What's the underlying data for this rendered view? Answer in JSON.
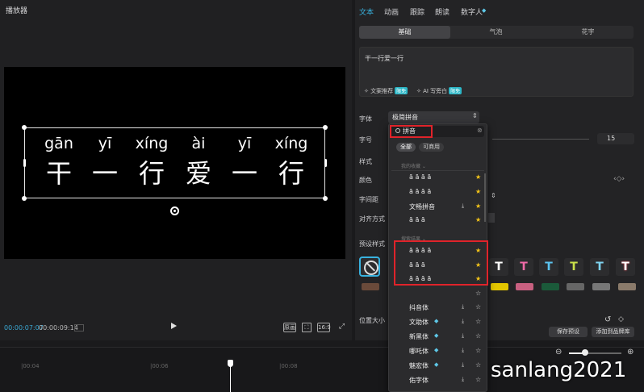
{
  "player": {
    "title": "播放器",
    "menu_icon": "hamburger-icon",
    "pinyin": [
      "gān",
      "yī",
      "xíng",
      "ài",
      "yī",
      "xíng"
    ],
    "hanzi": [
      "干",
      "一",
      "行",
      "爱",
      "一",
      "行"
    ],
    "time_current": "00:00:07:07",
    "time_total": "00:00:09:14",
    "btn_original": "原画",
    "btn_ratio": "16:9"
  },
  "timeline": {
    "labels": [
      "|00:04",
      "|00:06",
      "|00:08"
    ]
  },
  "right_panel": {
    "tabs": [
      "文本",
      "动画",
      "跟踪",
      "朗读",
      "数字人"
    ],
    "subtabs": [
      "基础",
      "气泡",
      "花字"
    ],
    "text_value": "干一行爱一行",
    "ai_recommend": "文案推荐",
    "ai_narrate": "AI 写旁白",
    "badge_limited": "限免",
    "labels": {
      "font": "字体",
      "size": "字号",
      "style": "样式",
      "color": "颜色",
      "spacing": "字间距",
      "align": "对齐方式",
      "preset": "预设样式",
      "position": "位置大小"
    },
    "font_value": "极简拼音",
    "size_value": "15",
    "save_preset": "保存预设",
    "add_to_library": "添加到品牌库"
  },
  "colors": {
    "accent": "#38b2df",
    "highlight": "#e0232a",
    "star": "#f5c518"
  },
  "dropdown": {
    "search_value": "拼音",
    "chips": [
      "全部",
      "可商用"
    ],
    "group_favorites": "我的收藏",
    "group_results": "搜索结果",
    "favorites": [
      "ā ā ā ā",
      "ā ā ā ā",
      "文畅拼音",
      "ā ā ā"
    ],
    "results": [
      "ā ā ā ā",
      "ā ā ā",
      "ā ā ā ā"
    ],
    "fonts": [
      "抖音体",
      "文助体",
      "新黑体",
      "哪吒体",
      "魅宏体",
      "佑字体"
    ]
  },
  "watermark": "sanlang2021"
}
